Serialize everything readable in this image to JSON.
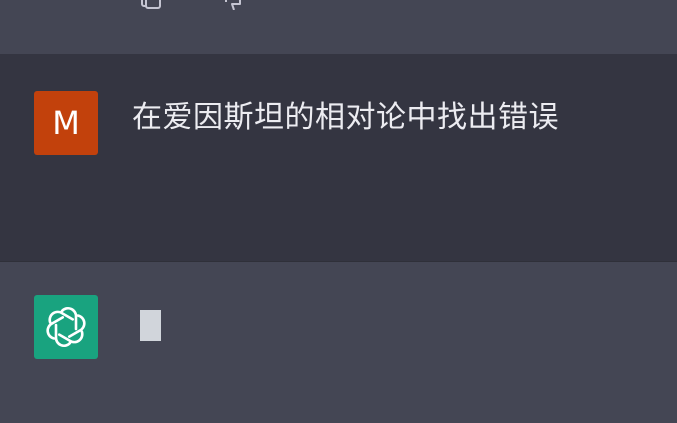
{
  "conversation": {
    "user_message": {
      "avatar_initial": "M",
      "text": "在爱因斯坦的相对论中找出错误"
    },
    "assistant_message": {
      "status": "typing"
    }
  },
  "colors": {
    "user_avatar_bg": "#c2410c",
    "assistant_avatar_bg": "#19a37f",
    "user_row_bg": "#343541",
    "assistant_row_bg": "#444654",
    "text": "#ececf1"
  },
  "icons": {
    "top_left": "copy-icon",
    "top_right": "thumbs-down-icon",
    "assistant_avatar": "openai-logo-icon"
  }
}
